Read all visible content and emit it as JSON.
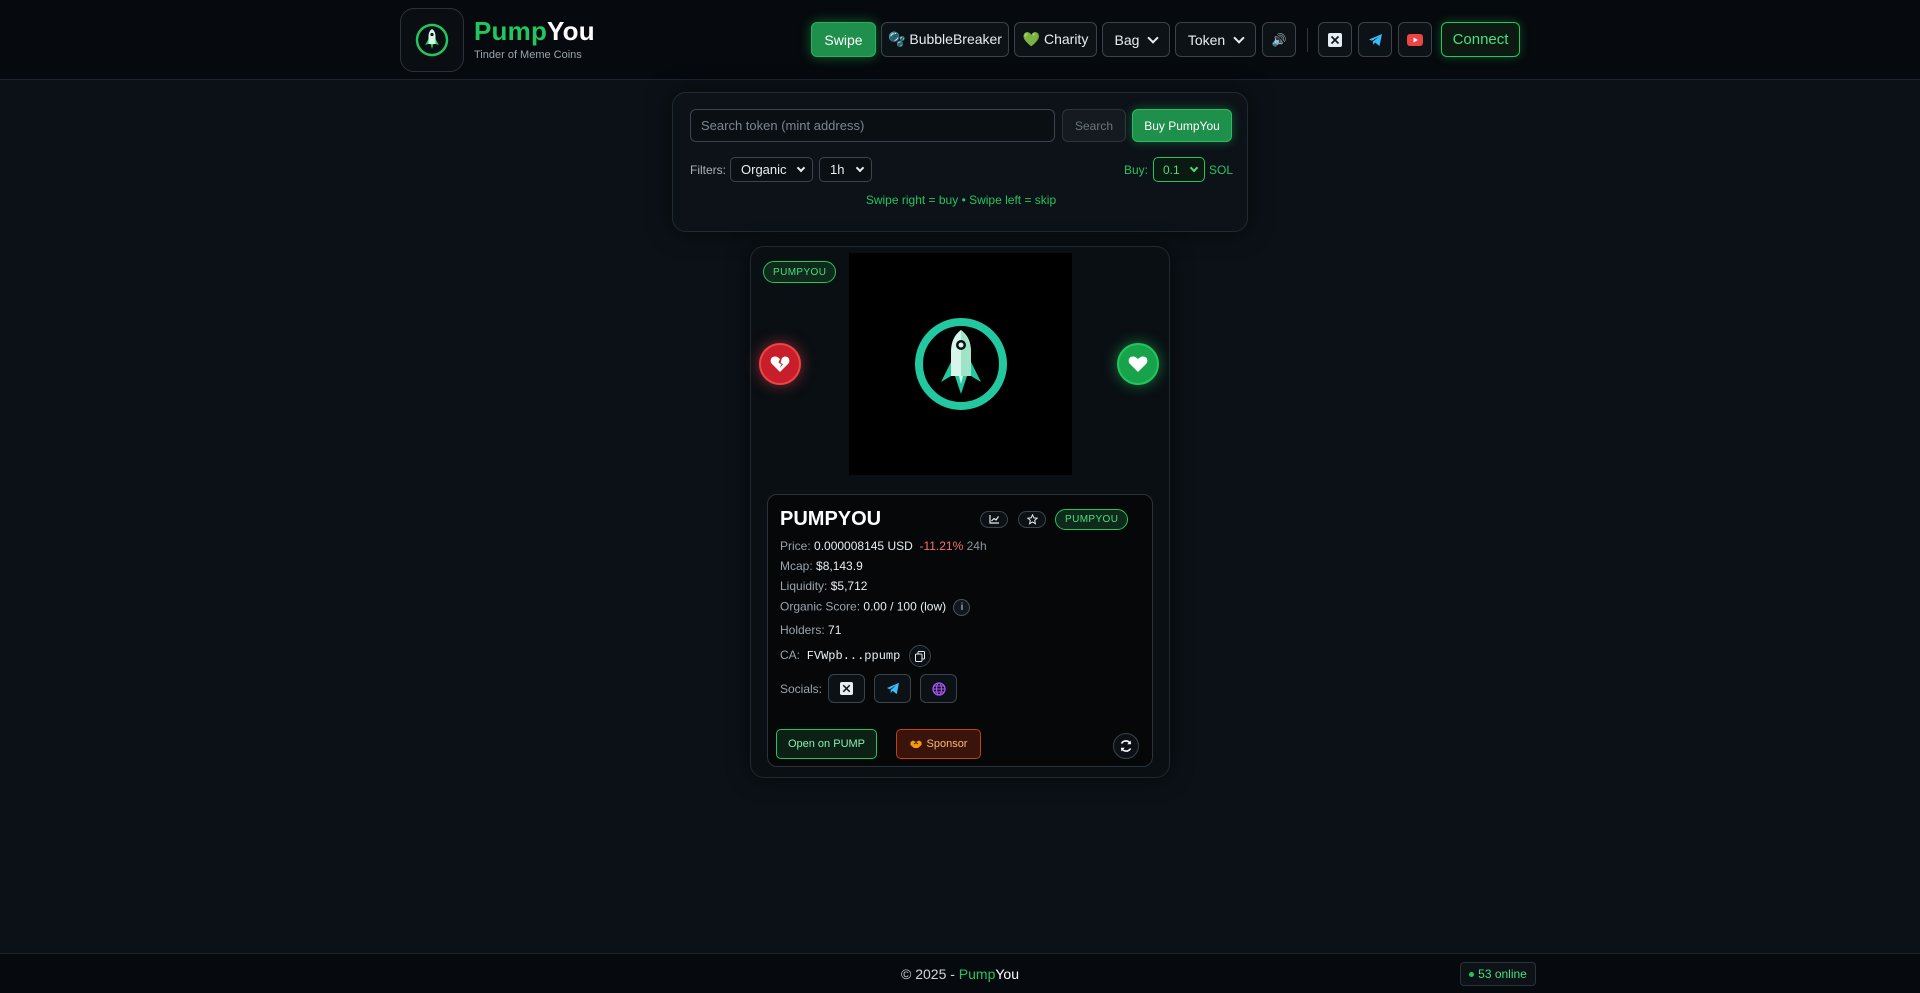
{
  "header": {
    "brand_part1": "Pump",
    "brand_part2": "You",
    "tagline": "Tinder of Meme Coins",
    "nav": {
      "swipe": "Swipe",
      "bubblebreaker": "🫧 BubbleBreaker",
      "charity": "💚 Charity",
      "bag": "Bag",
      "token": "Token",
      "extra": "🔊"
    },
    "connect": "Connect"
  },
  "search": {
    "placeholder": "Search token (mint address)",
    "search_button": "Search",
    "buy_button": "Buy PumpYou",
    "filters_label": "Filters:",
    "filter_type": "Organic",
    "filter_time": "1h",
    "buy_label": "Buy:",
    "buy_amount": "0.1",
    "currency": "SOL",
    "hint": "Swipe right = buy • Swipe left = skip"
  },
  "card": {
    "image_badge": "PUMPYOU",
    "name": "PUMPYOU",
    "symbol_badge": "PUMPYOU",
    "price_label": "Price:",
    "price": "0.000008145 USD",
    "change": "-11.21%",
    "change_period": "24h",
    "mcap_label": "Mcap:",
    "mcap": "$8,143.9",
    "liquidity_label": "Liquidity:",
    "liquidity": "$5,712",
    "organic_label": "Organic Score:",
    "organic": "0.00 / 100",
    "organic_level": "(low)",
    "info": "i",
    "holders_label": "Holders:",
    "holders": "71",
    "ca_label": "CA:",
    "ca": "FVWpb...ppump",
    "socials_label": "Socials:",
    "open_button": "Open on PUMP",
    "sponsor_button": "Sponsor"
  },
  "footer": {
    "copyright": "© 2025 - ",
    "brand_part1": "Pump",
    "brand_part2": "You",
    "online": "53 online"
  },
  "colors": {
    "accent": "#22c55e",
    "danger": "#ef4444",
    "background": "#0b1117"
  }
}
